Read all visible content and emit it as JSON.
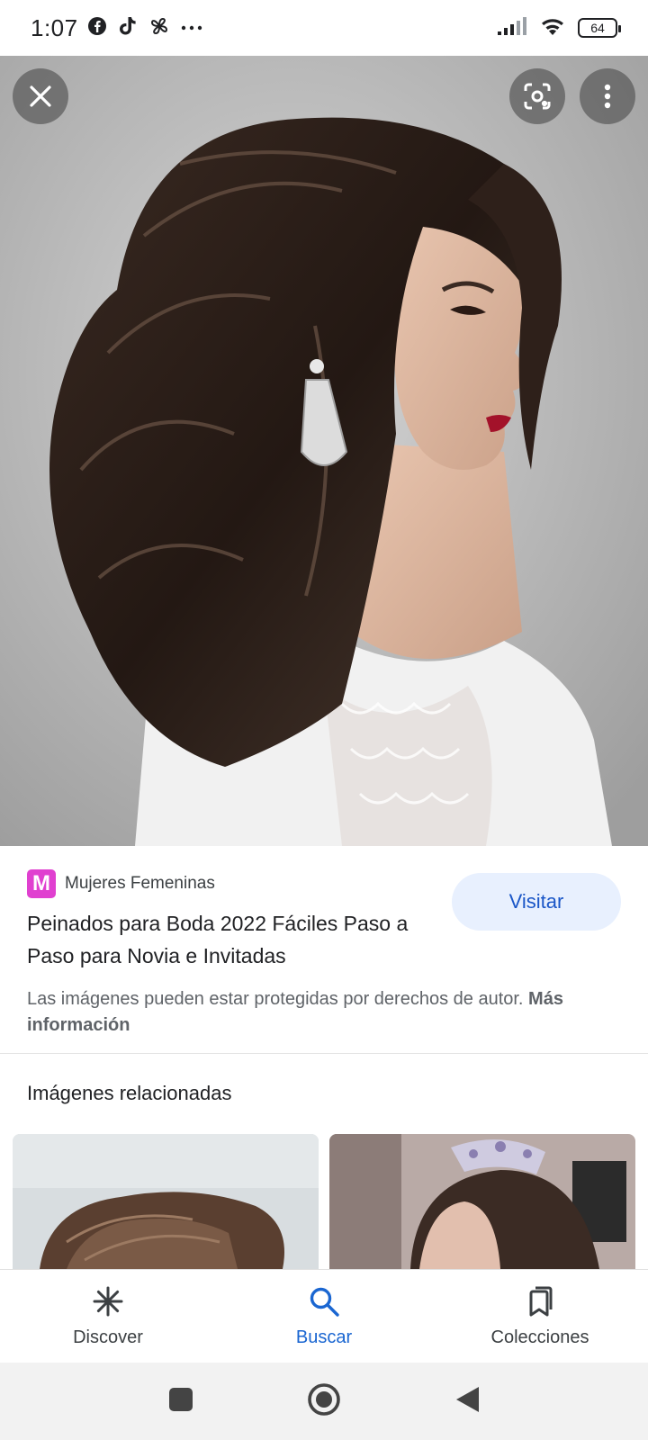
{
  "status_bar": {
    "time": "1:07",
    "left_icons": [
      "facebook-icon",
      "tiktok-icon",
      "pinwheel-icon",
      "more-dots-icon"
    ],
    "right_icons": [
      "signal-icon",
      "wifi-icon",
      "battery-icon"
    ],
    "battery_level": "64"
  },
  "viewer": {
    "close_icon": "close-icon",
    "lens_icon": "lens-icon",
    "menu_icon": "more-vert-icon"
  },
  "result": {
    "source_logo_letter": "M",
    "source_name": "Mujeres Femeninas",
    "title": "Peinados para Boda 2022 Fáciles Paso a Paso para Novia e Invitadas",
    "visit_label": "Visitar",
    "copyright_text": "Las imágenes pueden estar protegidas por derechos de autor.",
    "more_info_label": "Más información"
  },
  "related": {
    "title": "Imágenes relacionadas"
  },
  "bottom_nav": {
    "items": [
      {
        "label": "Discover",
        "icon": "asterisk-icon",
        "active": false
      },
      {
        "label": "Buscar",
        "icon": "search-icon",
        "active": true
      },
      {
        "label": "Colecciones",
        "icon": "bookmarks-icon",
        "active": false
      }
    ]
  },
  "system_nav": {
    "icons": [
      "recents-icon",
      "home-icon",
      "back-icon"
    ]
  },
  "colors": {
    "accent": "#1a66d1",
    "visit_bg": "#e8f0fe",
    "source_logo": "#e040d0"
  }
}
